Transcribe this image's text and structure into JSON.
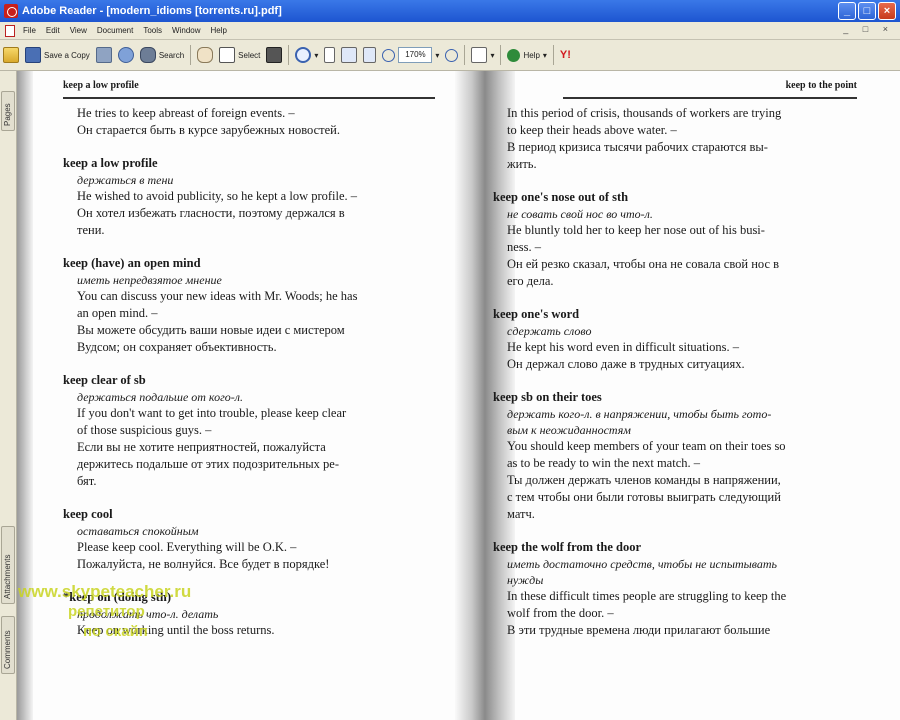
{
  "window": {
    "title": "Adobe Reader - [modern_idioms [torrents.ru].pdf]",
    "controls": [
      "_",
      "□",
      "×"
    ]
  },
  "menubar": {
    "items": [
      "File",
      "Edit",
      "View",
      "Document",
      "Tools",
      "Window",
      "Help"
    ],
    "right_controls": "_ □ ×"
  },
  "toolbar": {
    "save_copy_label": "Save a Copy",
    "search_label": "Search",
    "select_label": "Select",
    "zoom_value": "170%",
    "help_label": "Help",
    "yahoo_label": "Y!"
  },
  "sidepanel": {
    "tabs": [
      "Pages",
      "Attachments",
      "Comments"
    ]
  },
  "page_left": {
    "running_head": "keep a low profile",
    "entries": [
      {
        "term": "",
        "translation": "",
        "lines": [
          "He tries to keep abreast of foreign events. –",
          "Он старается быть в курсе зарубежных новостей."
        ]
      },
      {
        "term": "keep a low profile",
        "translation": "держаться в тени",
        "lines": [
          "He wished to avoid publicity, so he kept a low profile. –",
          "Он хотел избежать гласности, поэтому держался в",
          "тени."
        ]
      },
      {
        "term": "keep (have) an open mind",
        "translation": "иметь непредвзятое мнение",
        "lines": [
          "You can discuss your new ideas with Mr. Woods; he has",
          "an open mind. –",
          "Вы можете обсудить ваши новые идеи с мистером",
          "Вудсом; он сохраняет объективность."
        ]
      },
      {
        "term": "keep clear of sb",
        "translation": "держаться подальше от кого-л.",
        "lines": [
          "If you don't want to get into trouble, please keep clear",
          "of those suspicious guys. –",
          "Если вы не хотите неприятностей, пожалуйста",
          "держитесь подальше от этих подозрительных ре-",
          "бят."
        ]
      },
      {
        "term": "keep cool",
        "translation": "оставаться спокойным",
        "lines": [
          "Please keep cool. Everything will be O.K. –",
          "Пожалуйста, не волнуйся. Все будет в порядке!"
        ]
      },
      {
        "term": "*keep on (doing sth)",
        "translation": "продолжать что-л. делать",
        "lines": [
          "Keep on working until the boss returns."
        ]
      }
    ]
  },
  "page_right": {
    "running_head": "keep to the point",
    "entries": [
      {
        "term": "",
        "translation": "",
        "lines": [
          "In this period of crisis, thousands of workers are trying",
          "to keep their heads above water. –",
          "В период кризиса тысячи рабочих стараются вы-",
          "жить."
        ]
      },
      {
        "term": "keep one's nose out of sth",
        "translation": "не совать свой нос во что-л.",
        "lines": [
          "He bluntly told her to keep her nose out of his busi-",
          "ness. –",
          "Он ей резко сказал, чтобы она не совала свой нос в",
          "его дела."
        ]
      },
      {
        "term": "keep one's word",
        "translation": "сдержать слово",
        "lines": [
          "He kept his word even in difficult situations. –",
          "Он держал слово даже в трудных ситуациях."
        ]
      },
      {
        "term": "keep sb on their toes",
        "translation": "держать кого-л. в напряжении, чтобы быть гото-",
        "translation2": "вым к неожиданностям",
        "lines": [
          "You should keep members of your team on their toes so",
          "as to be ready to win the next match. –",
          "Ты должен держать членов команды в напряжении,",
          "с тем чтобы они были готовы выиграть следующий",
          "матч."
        ]
      },
      {
        "term": "keep the wolf from the door",
        "translation": "иметь достаточно средств, чтобы не испытывать",
        "translation2": "нужды",
        "lines": [
          "In these difficult times people are struggling to keep the",
          "wolf from the door. –",
          "В эти трудные времена люди прилагают большие"
        ]
      }
    ]
  },
  "watermark": {
    "line1": "www.skypeteacher.ru",
    "line2": "репетитор",
    "line3": "по скайп"
  }
}
